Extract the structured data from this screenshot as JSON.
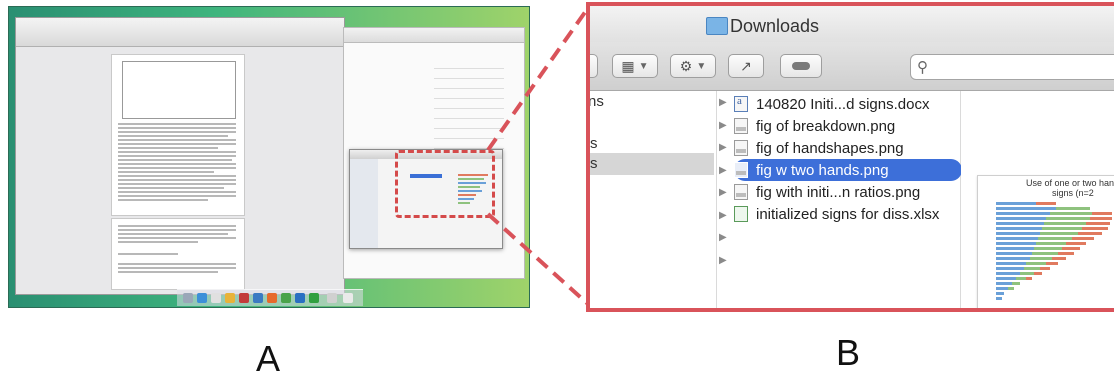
{
  "colors": {
    "accent_red": "#d9535a",
    "selection_blue": "#3d6fd9",
    "desktop_green": "#3fb57e"
  },
  "labels": {
    "a": "A",
    "b": "B"
  },
  "finder": {
    "title": "Downloads",
    "toolbar": {
      "view_icon": "list-view-icon",
      "action_icon": "gear-icon",
      "share_icon": "share-icon",
      "tag_icon": "tag-icon",
      "search_icon": "search-icon"
    },
    "sidebar": [
      {
        "label": "ns"
      },
      {
        "label": "s"
      },
      {
        "label": "s"
      }
    ],
    "files": [
      {
        "name": "140820 Initi...d signs.docx",
        "type": "docx"
      },
      {
        "name": "fig of breakdown.png",
        "type": "png"
      },
      {
        "name": "fig of handshapes.png",
        "type": "png"
      },
      {
        "name": "fig w two hands.png",
        "type": "png",
        "selected": true
      },
      {
        "name": "fig with initi...n ratios.png",
        "type": "png"
      },
      {
        "name": "initialized signs for diss.xlsx",
        "type": "xlsx"
      }
    ],
    "preview": {
      "title": "Use of one or two han",
      "subtitle": "signs (n=2"
    }
  }
}
